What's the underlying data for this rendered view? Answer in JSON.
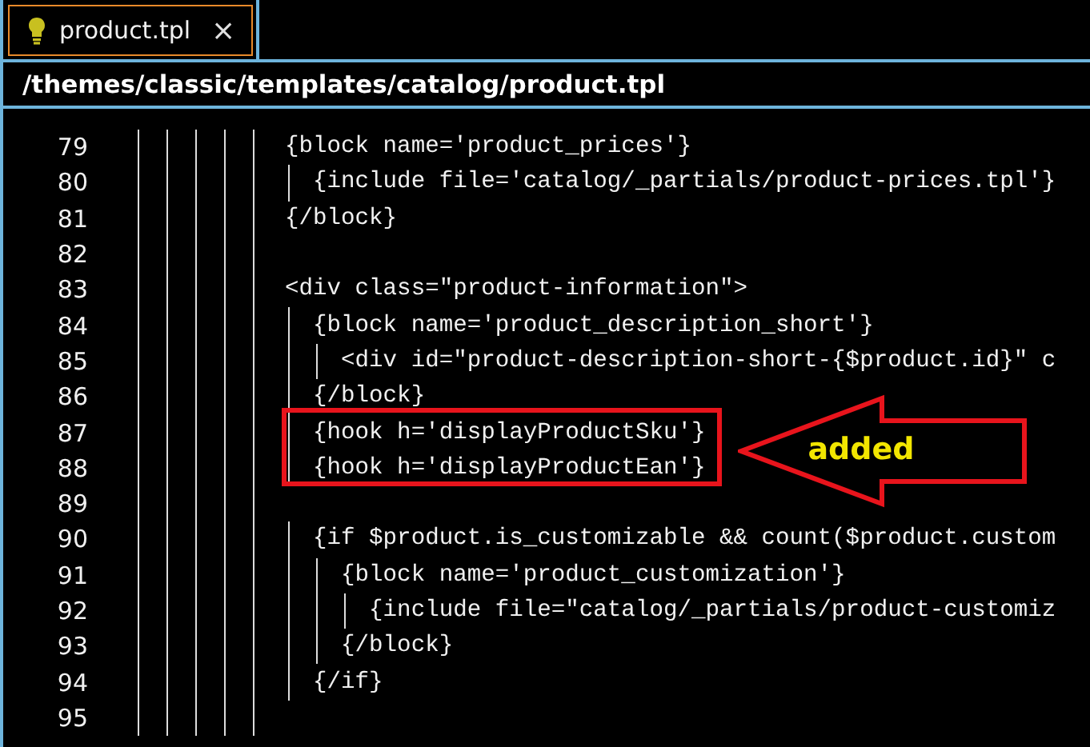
{
  "tabs": [
    {
      "label": "product.tpl",
      "close": "×",
      "selected": true
    }
  ],
  "path": "/themes/classic/templates/catalog/product.tpl",
  "lines": [
    {
      "number": "79",
      "code": "{block name='product_prices'}",
      "boxed": false
    },
    {
      "number": "80",
      "code": "  {include file='catalog/_partials/product-prices.tpl'}",
      "boxed": false
    },
    {
      "number": "81",
      "code": "{/block}",
      "boxed": false
    },
    {
      "number": "82",
      "boxed": false
    },
    {
      "number": "83",
      "code": "<div class=\"product-information\">",
      "boxed": false
    },
    {
      "number": "84",
      "code": "  {block name='product_description_short'}",
      "boxed": false
    },
    {
      "number": "85",
      "code": "    <div id=\"product-description-short-{$product.id}\" c",
      "boxed": false
    },
    {
      "number": "86",
      "code": "  {/block}",
      "boxed": false
    },
    {
      "number": "87",
      "code": "  {hook h='displayProductSku'}",
      "boxed": true
    },
    {
      "number": "88",
      "code": "  {hook h='displayProductEan'}",
      "boxed": true
    },
    {
      "number": "89",
      "boxed": false
    },
    {
      "number": "90",
      "code": "  {if $product.is_customizable && count($product.custom",
      "boxed": false
    },
    {
      "number": "91",
      "code": "    {block name='product_customization'}",
      "boxed": false
    },
    {
      "number": "92",
      "code": "      {include file=\"catalog/_partials/product-customiz",
      "boxed": false
    },
    {
      "number": "93",
      "code": "    {/block}",
      "boxed": false
    },
    {
      "number": "94",
      "code": "  {/if}",
      "boxed": false
    },
    {
      "number": "95",
      "boxed": false
    }
  ],
  "callout": {
    "label": "added"
  }
}
